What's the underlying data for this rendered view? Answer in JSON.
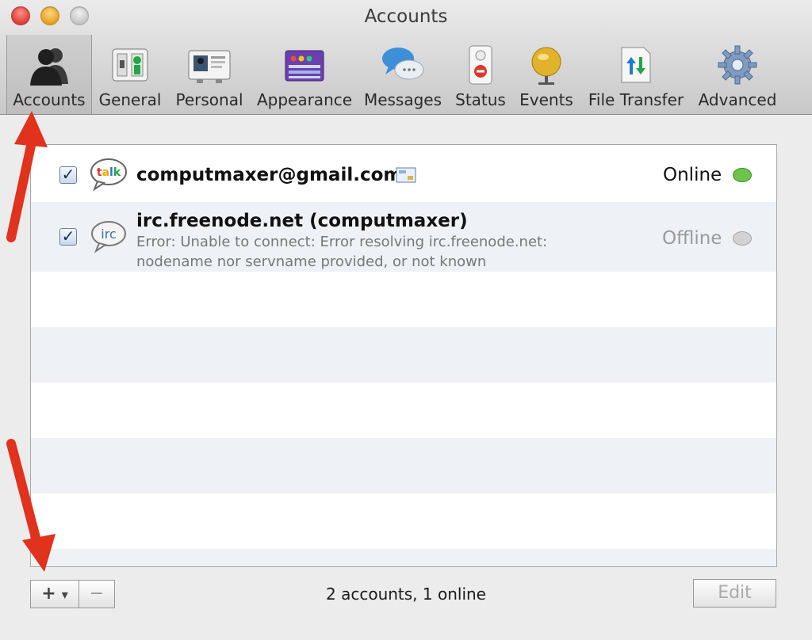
{
  "window": {
    "title": "Accounts"
  },
  "toolbar": {
    "items": [
      {
        "label": "Accounts",
        "icon": "people-icon"
      },
      {
        "label": "General",
        "icon": "switch-icon"
      },
      {
        "label": "Personal",
        "icon": "id-card-icon"
      },
      {
        "label": "Appearance",
        "icon": "palette-window-icon"
      },
      {
        "label": "Messages",
        "icon": "speech-bubbles-icon"
      },
      {
        "label": "Status",
        "icon": "door-hanger-icon"
      },
      {
        "label": "Events",
        "icon": "bell-icon"
      },
      {
        "label": "File Transfer",
        "icon": "transfer-arrows-icon"
      },
      {
        "label": "Advanced",
        "icon": "gear-icon"
      }
    ],
    "selected": "Accounts"
  },
  "accounts": [
    {
      "name": "computmaxer@gmail.com",
      "service": "talk",
      "enabled": true,
      "status": "Online",
      "status_color": "#5cb85c",
      "error": ""
    },
    {
      "name": "irc.freenode.net (computmaxer)",
      "service": "irc",
      "enabled": true,
      "status": "Offline",
      "status_color": "#c4c4c4",
      "error_line1": "Error: Unable to connect: Error resolving irc.freenode.net:",
      "error_line2": "nodename nor servname provided, or not known"
    }
  ],
  "footer": {
    "add_label": "+",
    "add_menu_glyph": "▾",
    "remove_label": "−",
    "summary": "2 accounts, 1 online",
    "edit_label": "Edit"
  },
  "colors": {
    "annotation_arrow": "#e0321c"
  }
}
